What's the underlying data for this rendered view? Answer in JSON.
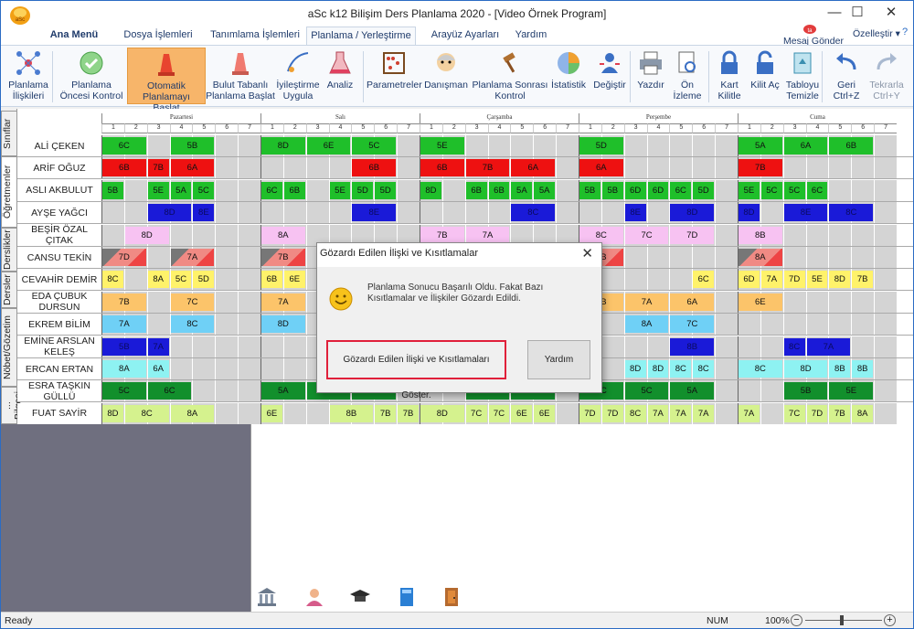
{
  "window": {
    "title": "aSc k12 Bilişim Ders Planlama 2020  -  [Video Örnek Program]"
  },
  "tabs": [
    "Ana Menü",
    "Dosya İşlemleri",
    "Tanımlama İşlemleri",
    "Planlama / Yerleştirme",
    "Arayüz Ayarları",
    "Yardım"
  ],
  "header_right": {
    "message": "Mesaj Gönder",
    "customize": "Özelleştir ▾"
  },
  "ribbon": [
    {
      "label": "Planlama İlişkileri",
      "icon": "relations-icon"
    },
    {
      "label": "Planlama Öncesi Kontrol",
      "icon": "check-icon"
    },
    {
      "label": "Otomatik Planlamayı Başlat",
      "icon": "auto-plan-icon"
    },
    {
      "label": "Bulut Tabanlı Planlama Başlat",
      "icon": "cloud-plan-icon"
    },
    {
      "label": "İyileştirme Uygula",
      "icon": "improve-icon"
    },
    {
      "label": "Analiz",
      "icon": "flask-icon"
    },
    {
      "label": "Parametreler",
      "icon": "abacus-icon"
    },
    {
      "label": "Danışman",
      "icon": "advisor-icon"
    },
    {
      "label": "Planlama Sonrası Kontrol",
      "icon": "gavel-icon"
    },
    {
      "label": "İstatistik",
      "icon": "pie-chart-icon"
    },
    {
      "label": "Değiştir",
      "icon": "swap-user-icon"
    },
    {
      "label": "Yazdır",
      "icon": "printer-icon"
    },
    {
      "label": "Ön İzleme",
      "icon": "preview-icon"
    },
    {
      "label": "Kart Kilitle",
      "icon": "lock-icon"
    },
    {
      "label": "Kilit Aç",
      "icon": "unlock-icon"
    },
    {
      "label": "Tabloyu Temizle",
      "icon": "recycle-icon"
    },
    {
      "label": "Geri Ctrl+Z",
      "icon": "undo-icon"
    },
    {
      "label": "Tekrarla Ctrl+Y",
      "icon": "redo-icon"
    }
  ],
  "side_tabs": [
    "Sınıflar",
    "Öğretmenler",
    "Derslikler",
    "Dersler",
    "Nöbet/Gözetim",
    "... Bilgesi"
  ],
  "days": [
    "Pazartesi",
    "Salı",
    "Çarşamba",
    "Perşembe",
    "Cuma"
  ],
  "periods": [
    "1",
    "2",
    "3",
    "4",
    "5",
    "6",
    "7"
  ],
  "colors": {
    "green": "#1fbf2a",
    "red": "#ee1111",
    "darkblue": "#1a1ad8",
    "pink": "#f7c2f2",
    "salmon": "#f08a84",
    "yellow": "#fff26a",
    "orange": "#fcc46a",
    "cyan": "#6fd0f6",
    "lightcyan": "#8ef2f2",
    "darkgreen": "#128f2c",
    "lime": "#d5f28e"
  },
  "teachers": [
    {
      "name": "ALİ ÇEKEN",
      "color": "green",
      "lessons": [
        [
          0,
          "6C",
          2
        ],
        [
          3,
          "5B",
          2
        ],
        [
          7,
          "8D",
          2
        ],
        [
          9,
          "6E",
          2
        ],
        [
          11,
          "5C",
          2
        ],
        [
          14,
          "5E",
          2
        ],
        [
          21,
          "5D",
          2
        ],
        [
          28,
          "5A",
          2
        ],
        [
          30,
          "6A",
          2
        ],
        [
          32,
          "6B",
          2
        ]
      ]
    },
    {
      "name": "ARİF OĞUZ",
      "color": "red",
      "lessons": [
        [
          0,
          "6B",
          2
        ],
        [
          2,
          "7B",
          1
        ],
        [
          3,
          "6A",
          2
        ],
        [
          11,
          "6B",
          2
        ],
        [
          14,
          "6B",
          2
        ],
        [
          16,
          "7B",
          2
        ],
        [
          18,
          "6A",
          2
        ],
        [
          21,
          "6A",
          2
        ],
        [
          28,
          "7B",
          2
        ]
      ]
    },
    {
      "name": "ASLI AKBULUT",
      "color": "green",
      "lessons": [
        [
          0,
          "5B",
          1
        ],
        [
          2,
          "5E",
          1
        ],
        [
          3,
          "5A",
          1
        ],
        [
          4,
          "5C",
          1
        ],
        [
          7,
          "6C",
          1
        ],
        [
          8,
          "6B",
          1
        ],
        [
          10,
          "5E",
          1
        ],
        [
          11,
          "5D",
          1
        ],
        [
          12,
          "5D",
          1
        ],
        [
          14,
          "8D",
          1
        ],
        [
          16,
          "6B",
          1
        ],
        [
          17,
          "6B",
          1
        ],
        [
          18,
          "5A",
          1
        ],
        [
          19,
          "5A",
          1
        ],
        [
          21,
          "5B",
          1
        ],
        [
          22,
          "5B",
          1
        ],
        [
          23,
          "6D",
          1
        ],
        [
          24,
          "6D",
          1
        ],
        [
          25,
          "6C",
          1
        ],
        [
          26,
          "5D",
          1
        ],
        [
          28,
          "5E",
          1
        ],
        [
          29,
          "5C",
          1
        ],
        [
          30,
          "5C",
          1
        ],
        [
          31,
          "6C",
          1
        ]
      ]
    },
    {
      "name": "AYŞE YAĞCI",
      "color": "darkblue",
      "lessons": [
        [
          2,
          "8D",
          2
        ],
        [
          4,
          "8E",
          1
        ],
        [
          11,
          "8E",
          2
        ],
        [
          18,
          "8C",
          2
        ],
        [
          23,
          "8E",
          1
        ],
        [
          25,
          "8D",
          2
        ],
        [
          28,
          "8D",
          1
        ],
        [
          30,
          "8E",
          2
        ],
        [
          32,
          "8C",
          2
        ]
      ]
    },
    {
      "name": "BEŞİR ÖZAL ÇITAK",
      "color": "pink",
      "lessons": [
        [
          1,
          "8D",
          2
        ],
        [
          7,
          "8A",
          2
        ],
        [
          14,
          "7B",
          2
        ],
        [
          16,
          "7A",
          2
        ],
        [
          21,
          "8C",
          2
        ],
        [
          23,
          "7C",
          2
        ],
        [
          25,
          "7D",
          2
        ],
        [
          28,
          "8B",
          2
        ]
      ]
    },
    {
      "name": "CANSU TEKİN",
      "color": "salmon",
      "lessons": [
        [
          0,
          "7D",
          2
        ],
        [
          3,
          "7A",
          2
        ],
        [
          7,
          "7B",
          2
        ],
        [
          21,
          "8B",
          2
        ],
        [
          28,
          "8A",
          2
        ]
      ]
    },
    {
      "name": "CEVAHİR DEMİR",
      "color": "yellow",
      "lessons": [
        [
          0,
          "8C",
          1
        ],
        [
          2,
          "8A",
          1
        ],
        [
          3,
          "5C",
          1
        ],
        [
          4,
          "5D",
          1
        ],
        [
          7,
          "6B",
          1
        ],
        [
          8,
          "6E",
          1
        ],
        [
          26,
          "6C",
          1
        ],
        [
          28,
          "6D",
          1
        ],
        [
          29,
          "7A",
          1
        ],
        [
          30,
          "7D",
          1
        ],
        [
          31,
          "5E",
          1
        ],
        [
          32,
          "8D",
          1
        ],
        [
          33,
          "7B",
          1
        ]
      ]
    },
    {
      "name": "EDA ÇUBUK DURSUN",
      "color": "orange",
      "lessons": [
        [
          0,
          "7B",
          2
        ],
        [
          3,
          "7C",
          2
        ],
        [
          7,
          "7A",
          2
        ],
        [
          21,
          "7B",
          2
        ],
        [
          23,
          "7A",
          2
        ],
        [
          25,
          "6A",
          2
        ],
        [
          28,
          "6E",
          2
        ]
      ]
    },
    {
      "name": "EKREM BİLİM",
      "color": "cyan",
      "lessons": [
        [
          0,
          "7A",
          2
        ],
        [
          3,
          "8C",
          2
        ],
        [
          7,
          "8D",
          2
        ],
        [
          23,
          "8A",
          2
        ],
        [
          25,
          "7C",
          2
        ]
      ]
    },
    {
      "name": "EMİNE ARSLAN KELEŞ",
      "color": "darkblue",
      "lessons": [
        [
          0,
          "5B",
          2
        ],
        [
          2,
          "7A",
          1
        ],
        [
          25,
          "8B",
          2
        ],
        [
          30,
          "8C",
          1
        ],
        [
          31,
          "7A",
          2
        ]
      ]
    },
    {
      "name": "ERCAN ERTAN",
      "color": "lightcyan",
      "lessons": [
        [
          0,
          "8A",
          2
        ],
        [
          2,
          "6A",
          1
        ],
        [
          23,
          "8D",
          1
        ],
        [
          24,
          "8D",
          1
        ],
        [
          25,
          "8C",
          1
        ],
        [
          26,
          "8C",
          1
        ],
        [
          28,
          "8C",
          2
        ],
        [
          30,
          "8D",
          2
        ],
        [
          32,
          "8B",
          1
        ],
        [
          33,
          "8B",
          1
        ]
      ]
    },
    {
      "name": "ESRA TAŞKIN GÜLLÜ",
      "color": "darkgreen",
      "lessons": [
        [
          0,
          "5C",
          2
        ],
        [
          2,
          "6C",
          2
        ],
        [
          7,
          "5A",
          2
        ],
        [
          9,
          "5D",
          2
        ],
        [
          11,
          "5B",
          2
        ],
        [
          16,
          "5D",
          2
        ],
        [
          18,
          "5E",
          2
        ],
        [
          21,
          "6C",
          2
        ],
        [
          23,
          "5C",
          2
        ],
        [
          25,
          "5A",
          2
        ],
        [
          30,
          "5B",
          2
        ],
        [
          32,
          "5E",
          2
        ]
      ]
    },
    {
      "name": "FUAT SAYİR",
      "color": "lime",
      "lessons": [
        [
          0,
          "8D",
          1
        ],
        [
          1,
          "8C",
          2
        ],
        [
          3,
          "8A",
          2
        ],
        [
          7,
          "6E",
          1
        ],
        [
          10,
          "8B",
          2
        ],
        [
          12,
          "7B",
          1
        ],
        [
          13,
          "7B",
          1
        ],
        [
          14,
          "8D",
          2
        ],
        [
          16,
          "7C",
          1
        ],
        [
          17,
          "7C",
          1
        ],
        [
          18,
          "6E",
          1
        ],
        [
          19,
          "6E",
          1
        ],
        [
          21,
          "7D",
          1
        ],
        [
          22,
          "7D",
          1
        ],
        [
          23,
          "8C",
          1
        ],
        [
          24,
          "7A",
          1
        ],
        [
          25,
          "7A",
          1
        ],
        [
          26,
          "7A",
          1
        ],
        [
          28,
          "7A",
          1
        ],
        [
          30,
          "7C",
          1
        ],
        [
          31,
          "7D",
          1
        ],
        [
          32,
          "7B",
          1
        ],
        [
          33,
          "8A",
          1
        ]
      ]
    }
  ],
  "dialog": {
    "title": "Gözardı Edilen İlişki ve Kısıtlamalar",
    "message": "Planlama Sonucu Başarılı Oldu. Fakat Bazı Kısıtlamalar ve İlişkiler Gözardı Edildi.",
    "show_button": "Gözardı Edilen İlişki ve Kısıtlamaları Göster.",
    "help_button": "Yardım"
  },
  "statusbar": {
    "ready": "Ready",
    "num": "NUM",
    "zoom": "100%"
  }
}
